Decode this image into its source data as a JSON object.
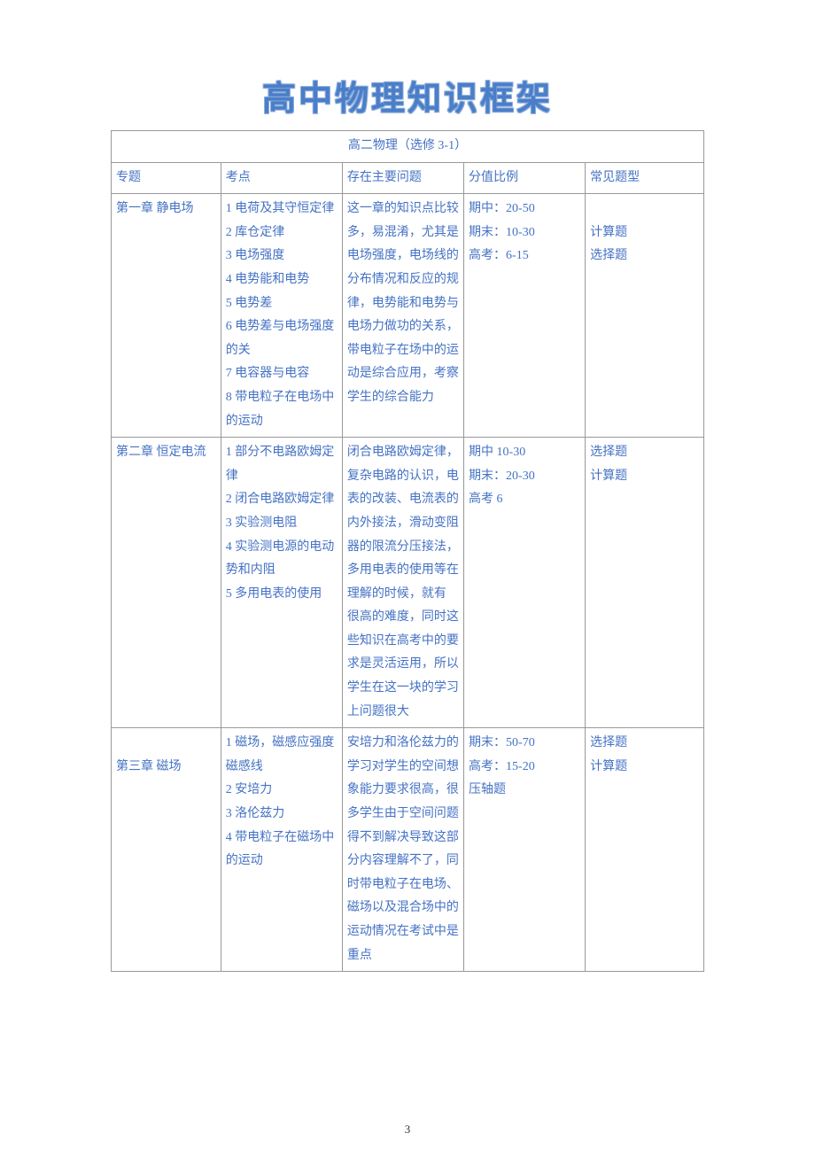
{
  "title": "高中物理知识框架",
  "table_title": "高二物理（选修 3-1）",
  "headers": {
    "col1": "专题",
    "col2": "考点",
    "col3": "存在主要问题",
    "col4": "分值比例",
    "col5": "常见题型"
  },
  "rows": [
    {
      "topic": "第一章 静电场",
      "points": "1 电荷及其守恒定律\n2 库仓定律\n3 电场强度\n4 电势能和电势\n5 电势差\n6 电势差与电场强度的关\n7 电容器与电容\n8 带电粒子在电场中的运动",
      "problems": "这一章的知识点比较多，易混淆，尤其是电场强度，电场线的分布情况和反应的规律，电势能和电势与电场力做功的关系，带电粒子在场中的运动是综合应用，考察学生的综合能力",
      "scores": "期中：20-50\n期末：10-30\n高考：6-15",
      "qtypes": "\n计算题\n选择题"
    },
    {
      "topic": "第二章 恒定电流",
      "points": "1 部分不电路欧姆定律\n2 闭合电路欧姆定律\n3 实验测电阻\n4 实验测电源的电动势和内阻\n5 多用电表的使用",
      "problems": "闭合电路欧姆定律，复杂电路的认识，电表的改装、电流表的内外接法，滑动变阻器的限流分压接法，多用电表的使用等在理解的时候，就有 很高的难度，同时这些知识在高考中的要求是灵活运用，所以学生在这一块的学习上问题很大",
      "scores": "期中 10-30\n期末：20-30\n高考 6",
      "qtypes": "选择题\n计算题"
    },
    {
      "topic": "\n第三章   磁场",
      "points": "1 磁场，磁感应强度 磁感线\n2 安培力\n3 洛伦兹力\n4 带电粒子在磁场中的运动",
      "problems": "安培力和洛伦兹力的学习对学生的空间想象能力要求很高，很多学生由于空间问题得不到解决导致这部分内容理解不了，同时带电粒子在电场、磁场以及混合场中的运动情况在考试中是重点",
      "scores": "期末：50-70\n高考：15-20\n压轴题",
      "qtypes": "选择题\n计算题"
    }
  ],
  "page_number": "3"
}
